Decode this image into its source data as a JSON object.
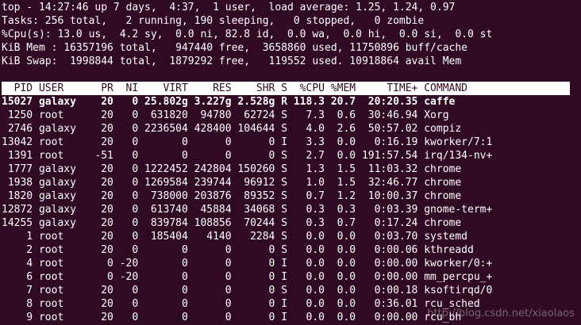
{
  "summary": {
    "top": "top - 14:27:46 up 7 days,  4:37,  1 user,  load average: 1.25, 1.24, 0.97",
    "tasks": "Tasks: 256 total,   2 running, 190 sleeping,   0 stopped,   0 zombie",
    "cpu": "%Cpu(s): 13.0 us,  4.2 sy,  0.0 ni, 82.8 id,  0.0 wa,  0.0 hi,  0.0 si,  0.0 st",
    "mem": "KiB Mem : 16357196 total,   947440 free,  3658860 used, 11750896 buff/cache",
    "swap": "KiB Swap:  1998844 total,  1879292 free,   119552 used. 10918864 avail Mem"
  },
  "table": {
    "columns": [
      "PID",
      "USER",
      "PR",
      "NI",
      "VIRT",
      "RES",
      "SHR",
      "S",
      "%CPU",
      "%MEM",
      "TIME+",
      "COMMAND"
    ],
    "header_line": "  PID USER      PR  NI    VIRT    RES    SHR S  %CPU %MEM     TIME+ COMMAND",
    "rows": [
      {
        "pid": "15027",
        "user": "galaxy",
        "pr": "20",
        "ni": "0",
        "virt": "25.802g",
        "res": "3.227g",
        "shr": "2.528g",
        "s": "R",
        "cpu": "118.3",
        "mem": "20.7",
        "time": "20:20.35",
        "command": "caffe",
        "bold": true
      },
      {
        "pid": "1250",
        "user": "root",
        "pr": "20",
        "ni": "0",
        "virt": "631820",
        "res": "94780",
        "shr": "62724",
        "s": "S",
        "cpu": "7.3",
        "mem": "0.6",
        "time": "30:46.94",
        "command": "Xorg"
      },
      {
        "pid": "2746",
        "user": "galaxy",
        "pr": "20",
        "ni": "0",
        "virt": "2236504",
        "res": "428400",
        "shr": "104644",
        "s": "S",
        "cpu": "4.0",
        "mem": "2.6",
        "time": "50:57.02",
        "command": "compiz"
      },
      {
        "pid": "13042",
        "user": "root",
        "pr": "20",
        "ni": "0",
        "virt": "0",
        "res": "0",
        "shr": "0",
        "s": "I",
        "cpu": "3.3",
        "mem": "0.0",
        "time": "0:16.19",
        "command": "kworker/7:1"
      },
      {
        "pid": "1391",
        "user": "root",
        "pr": "-51",
        "ni": "0",
        "virt": "0",
        "res": "0",
        "shr": "0",
        "s": "S",
        "cpu": "2.7",
        "mem": "0.0",
        "time": "191:57.54",
        "command": "irq/134-nv+"
      },
      {
        "pid": "1777",
        "user": "galaxy",
        "pr": "20",
        "ni": "0",
        "virt": "1222452",
        "res": "242804",
        "shr": "150260",
        "s": "S",
        "cpu": "1.3",
        "mem": "1.5",
        "time": "11:03.32",
        "command": "chrome"
      },
      {
        "pid": "1938",
        "user": "galaxy",
        "pr": "20",
        "ni": "0",
        "virt": "1269584",
        "res": "239744",
        "shr": "96912",
        "s": "S",
        "cpu": "1.0",
        "mem": "1.5",
        "time": "32:46.77",
        "command": "chrome"
      },
      {
        "pid": "1820",
        "user": "galaxy",
        "pr": "20",
        "ni": "0",
        "virt": "738000",
        "res": "203876",
        "shr": "89352",
        "s": "S",
        "cpu": "0.7",
        "mem": "1.2",
        "time": "10:00.37",
        "command": "chrome"
      },
      {
        "pid": "12872",
        "user": "galaxy",
        "pr": "20",
        "ni": "0",
        "virt": "613740",
        "res": "45884",
        "shr": "34068",
        "s": "S",
        "cpu": "0.3",
        "mem": "0.3",
        "time": "0:03.39",
        "command": "gnome-term+"
      },
      {
        "pid": "14255",
        "user": "galaxy",
        "pr": "20",
        "ni": "0",
        "virt": "839784",
        "res": "108856",
        "shr": "70244",
        "s": "S",
        "cpu": "0.3",
        "mem": "0.7",
        "time": "0:17.24",
        "command": "chrome"
      },
      {
        "pid": "1",
        "user": "root",
        "pr": "20",
        "ni": "0",
        "virt": "185404",
        "res": "4140",
        "shr": "2284",
        "s": "S",
        "cpu": "0.0",
        "mem": "0.0",
        "time": "0:03.70",
        "command": "systemd"
      },
      {
        "pid": "2",
        "user": "root",
        "pr": "20",
        "ni": "0",
        "virt": "0",
        "res": "0",
        "shr": "0",
        "s": "S",
        "cpu": "0.0",
        "mem": "0.0",
        "time": "0:00.06",
        "command": "kthreadd"
      },
      {
        "pid": "4",
        "user": "root",
        "pr": "0",
        "ni": "-20",
        "virt": "0",
        "res": "0",
        "shr": "0",
        "s": "I",
        "cpu": "0.0",
        "mem": "0.0",
        "time": "0:00.00",
        "command": "kworker/0:+"
      },
      {
        "pid": "6",
        "user": "root",
        "pr": "0",
        "ni": "-20",
        "virt": "0",
        "res": "0",
        "shr": "0",
        "s": "I",
        "cpu": "0.0",
        "mem": "0.0",
        "time": "0:00.00",
        "command": "mm_percpu_+"
      },
      {
        "pid": "7",
        "user": "root",
        "pr": "20",
        "ni": "0",
        "virt": "0",
        "res": "0",
        "shr": "0",
        "s": "S",
        "cpu": "0.0",
        "mem": "0.0",
        "time": "0:00.18",
        "command": "ksoftirqd/0"
      },
      {
        "pid": "8",
        "user": "root",
        "pr": "20",
        "ni": "0",
        "virt": "0",
        "res": "0",
        "shr": "0",
        "s": "I",
        "cpu": "0.0",
        "mem": "0.0",
        "time": "0:36.01",
        "command": "rcu_sched"
      },
      {
        "pid": "9",
        "user": "root",
        "pr": "20",
        "ni": "0",
        "virt": "0",
        "res": "0",
        "shr": "0",
        "s": "I",
        "cpu": "0.0",
        "mem": "0.0",
        "time": "0:00.00",
        "command": "rcu_bh"
      }
    ]
  },
  "watermark": "http://blog.csdn.net/xiaolaos",
  "colors": {
    "background": "#300a24",
    "foreground": "#ffffff",
    "header_bg": "#ffffff",
    "header_fg": "#300a24"
  }
}
